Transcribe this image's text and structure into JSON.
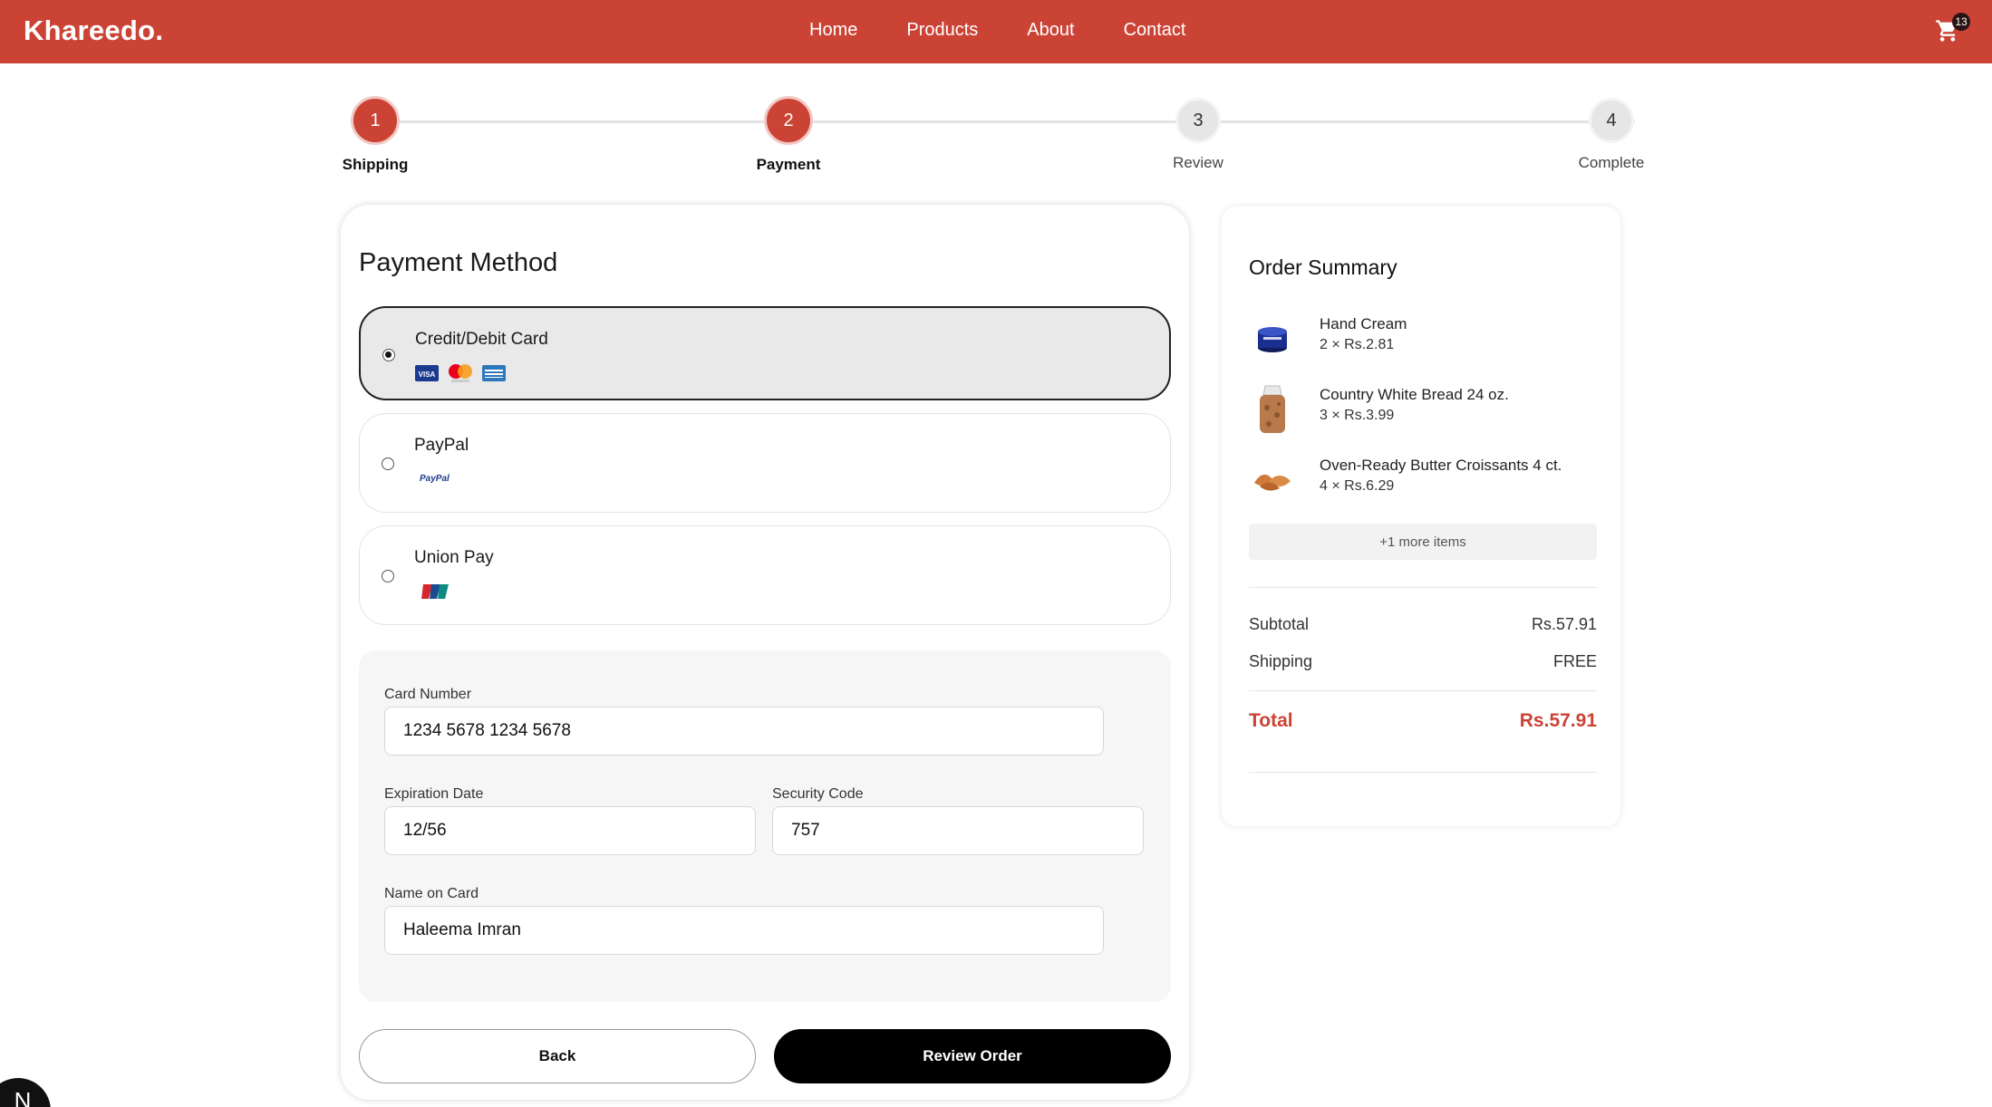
{
  "header": {
    "brand": "Khareedo.",
    "nav": [
      "Home",
      "Products",
      "About",
      "Contact"
    ],
    "cart_count": "13"
  },
  "stepper": {
    "steps": [
      {
        "number": "1",
        "label": "Shipping",
        "state": "active"
      },
      {
        "number": "2",
        "label": "Payment",
        "state": "active"
      },
      {
        "number": "3",
        "label": "Review",
        "state": "inactive"
      },
      {
        "number": "4",
        "label": "Complete",
        "state": "inactive"
      }
    ]
  },
  "payment": {
    "title": "Payment Method",
    "methods": [
      {
        "label": "Credit/Debit Card",
        "selected": true,
        "logos": [
          "visa-logo",
          "mastercard-logo",
          "amex-logo"
        ]
      },
      {
        "label": "PayPal",
        "selected": false,
        "logos": [
          "paypal-logo"
        ],
        "logo_text": "PayPal"
      },
      {
        "label": "Union Pay",
        "selected": false,
        "logos": [
          "unionpay-logo"
        ]
      }
    ],
    "form": {
      "card_number_label": "Card Number",
      "card_number_value": "1234 5678 1234 5678",
      "expiration_label": "Expiration Date",
      "expiration_value": "12/56",
      "security_label": "Security Code",
      "security_value": "757",
      "name_label": "Name on Card",
      "name_value": "Haleema Imran"
    },
    "back_label": "Back",
    "review_label": "Review Order"
  },
  "summary": {
    "title": "Order Summary",
    "items": [
      {
        "name": "Hand Cream",
        "qty": "2 × Rs.2.81",
        "icon": "hand-cream-image"
      },
      {
        "name": "Country White Bread 24 oz.",
        "qty": "3 × Rs.3.99",
        "icon": "bread-image"
      },
      {
        "name": "Oven-Ready Butter Croissants 4 ct.",
        "qty": "4 × Rs.6.29",
        "icon": "croissants-image"
      }
    ],
    "more_items": "+1 more items",
    "subtotal_label": "Subtotal",
    "subtotal_value": "Rs.57.91",
    "shipping_label": "Shipping",
    "shipping_value": "FREE",
    "total_label": "Total",
    "total_value": "Rs.57.91"
  },
  "dev_badge": "N",
  "colors": {
    "brand": "#cb4335",
    "dark": "#000000"
  }
}
